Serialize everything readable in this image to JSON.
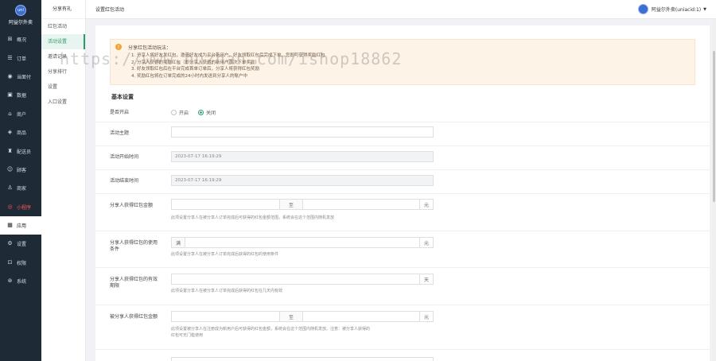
{
  "brand": {
    "name": "阿益尔外卖",
    "logo_text": "uni"
  },
  "sidebar": {
    "items": [
      {
        "label": "概况",
        "icon": "grid-icon"
      },
      {
        "label": "订单",
        "icon": "order-icon"
      },
      {
        "label": "当面付",
        "icon": "pay-icon"
      },
      {
        "label": "数据",
        "icon": "data-icon"
      },
      {
        "label": "商户",
        "icon": "shop-icon"
      },
      {
        "label": "商品",
        "icon": "goods-icon"
      },
      {
        "label": "配送员",
        "icon": "rider-icon"
      },
      {
        "label": "顾客",
        "icon": "user-icon"
      },
      {
        "label": "商家",
        "icon": "merchant-icon"
      },
      {
        "label": "小程序",
        "icon": "miniapp-icon"
      },
      {
        "label": "应用",
        "icon": "app-icon"
      },
      {
        "label": "设置",
        "icon": "settings-icon"
      },
      {
        "label": "权限",
        "icon": "lock-icon"
      },
      {
        "label": "系统",
        "icon": "system-icon"
      }
    ]
  },
  "submenu": {
    "title": "分享有礼",
    "items": [
      "红包活动",
      "活动设置",
      "邀请记录",
      "分享排行",
      "设置",
      "入口设置"
    ]
  },
  "header": {
    "title": "设置红包活动",
    "user": "阿益尔外卖(uniacid:1)"
  },
  "tips": {
    "title": "分享红包活动玩法：",
    "lines": [
      "1. 分享人将好友发红包，邀请好友成为平台新用户，好友领取红包后完成下单，您即可获得奖励红包",
      "2. 分享人获得的奖励红包（即分享人获得的新用户首次下单奖励）",
      "3. 好友领取红包后在平台完成首单订单后，分享人将获得红包奖励",
      "4. 奖励红包将在订单完成的24小时内发送到分享人的账户中"
    ]
  },
  "watermark": "https://www.huzhan.com/ishop18862",
  "form": {
    "section_title": "基本设置",
    "status": {
      "label": "是否开启",
      "options": [
        "开启",
        "关闭"
      ],
      "selected": 1
    },
    "name": {
      "label": "活动主题",
      "value": ""
    },
    "start_time": {
      "label": "活动开始时间",
      "value": "2023-07-17 16:19:29"
    },
    "end_time": {
      "label": "活动结束时间",
      "value": "2023-07-17 16:19:29"
    },
    "sharer_amount": {
      "label": "分享人获得红包金额",
      "range_sep": "至",
      "unit": "元",
      "hint": "此项设置分享人在被分享人订单完成后可获得的红包金额范围，系统会在这个范围内随机发放"
    },
    "sharer_condition": {
      "label": "分享人获得红包的使用条件",
      "prefix": "满",
      "unit": "元",
      "hint": "此项设置分享人在被分享人订单完成后获得的红包的使用条件"
    },
    "sharer_valid": {
      "label": "分享人获得红包的有效期限",
      "unit": "天",
      "hint": "此项设置分享人在被分享人订单完成后获得的红包在几天内有效"
    },
    "invitee_amount": {
      "label": "被分享人获得红包金额",
      "range_sep": "至",
      "unit": "元",
      "hint1": "此项设置被分享人在注册成为新用户后可获得的红包金额，系统会在这个范围内随机发放。注意：被分享人获得的",
      "hint2": "红包可无门槛使用"
    }
  }
}
